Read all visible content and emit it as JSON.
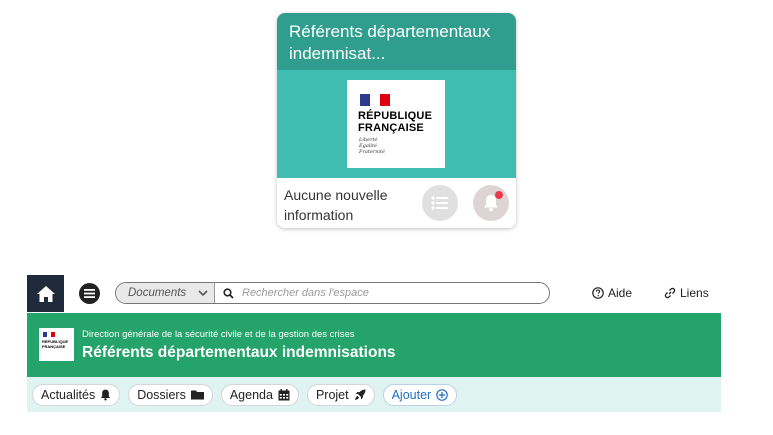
{
  "card": {
    "title": "Référents départementaux indemnisat...",
    "logo": {
      "line1": "RÉPUBLIQUE",
      "line2": "FRANÇAISE",
      "motto": [
        "Liberté",
        "Égalité",
        "Fraternité"
      ]
    },
    "info": "Aucune nouvelle information",
    "icons": {
      "list": "list-icon",
      "bell": "bell-icon"
    },
    "notification_dot": true
  },
  "nav": {
    "home_icon": "home-icon",
    "menu_icon": "menu-icon",
    "search": {
      "scope": "Documents",
      "placeholder": "Rechercher dans l'espace"
    },
    "help": "Aide",
    "links": "Liens"
  },
  "banner": {
    "logo": {
      "line1": "RÉPUBLIQUE",
      "line2": "FRANÇAISE"
    },
    "subtitle": "Direction générale de la sécurité civile et de la gestion des crises",
    "title": "Référents départementaux indemnisations"
  },
  "tabs": [
    {
      "label": "Actualités",
      "icon": "bell-icon"
    },
    {
      "label": "Dossiers",
      "icon": "folder-icon"
    },
    {
      "label": "Agenda",
      "icon": "calendar-icon"
    },
    {
      "label": "Projet",
      "icon": "rocket-icon"
    },
    {
      "label": "Ajouter",
      "icon": "add-circle-icon"
    }
  ],
  "colors": {
    "card_header": "#2f9e8e",
    "card_body": "#40bdb0",
    "banner": "#24a36a",
    "tabs_bg": "#dff3f0",
    "home_bg": "#1f2a3a",
    "accent_blue": "#1f6fbf",
    "notification_red": "#e83a4d"
  }
}
